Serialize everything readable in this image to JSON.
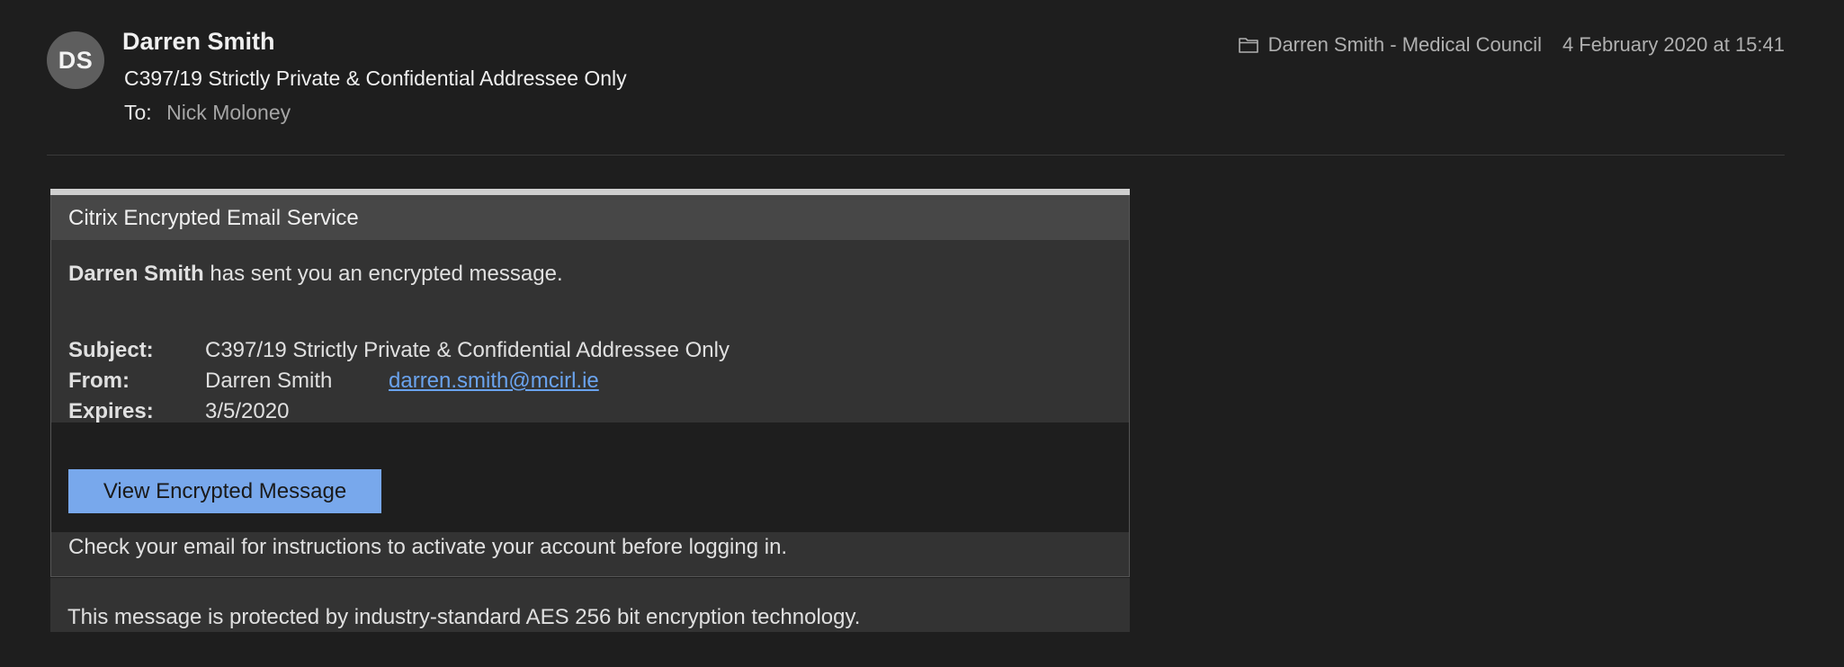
{
  "header": {
    "avatar_initials": "DS",
    "sender_name": "Darren Smith",
    "subject": "C397/19 Strictly Private & Confidential Addressee Only",
    "to_label": "To:",
    "to_value": "Nick Moloney",
    "mailbox": "Darren Smith - Medical Council",
    "mailbox_icon": "folder-icon",
    "date": "4 February 2020 at 15:41"
  },
  "card": {
    "title": "Citrix Encrypted Email Service",
    "intro_sender": "Darren Smith",
    "intro_text": " has sent you an encrypted message.",
    "subject_label": "Subject:",
    "subject_value": "C397/19 Strictly Private & Confidential Addressee Only",
    "from_label": "From:",
    "from_name": "Darren Smith",
    "from_email": "darren.smith@mcirl.ie",
    "expires_label": "Expires:",
    "expires_value": "3/5/2020",
    "button_label": "View Encrypted Message",
    "instructions": "Check your email for instructions to activate your account before logging in.",
    "footer": "This message is protected by industry-standard AES 256 bit encryption technology."
  },
  "colors": {
    "background": "#1e1e1e",
    "card": "#333333",
    "title_bar": "#474747",
    "button": "#78a8ec",
    "link": "#6aa3ee"
  }
}
